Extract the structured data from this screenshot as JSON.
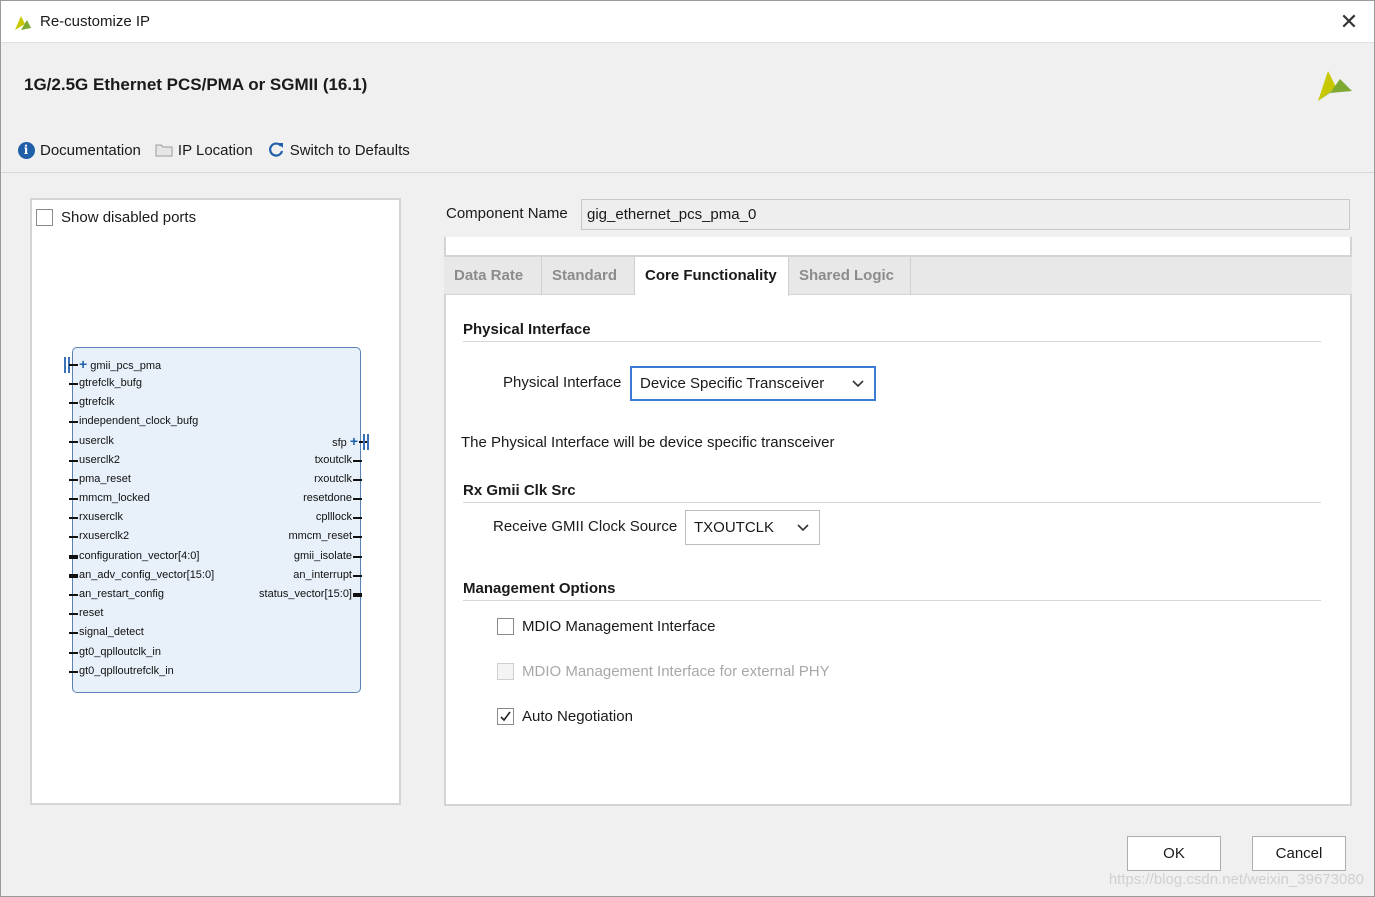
{
  "window": {
    "title": "Re-customize IP",
    "close_icon": "close-icon"
  },
  "header": {
    "ip_title": "1G/2.5G Ethernet PCS/PMA or SGMII (16.1)",
    "toolbar": [
      {
        "label": "Documentation",
        "icon": "info-icon"
      },
      {
        "label": "IP Location",
        "icon": "folder-icon"
      },
      {
        "label": "Switch to Defaults",
        "icon": "refresh-icon"
      }
    ]
  },
  "left_panel": {
    "show_disabled_ports": {
      "label": "Show disabled ports",
      "checked": false
    },
    "block": {
      "interface_top": "gmii_pcs_pma",
      "inputs": [
        "gtrefclk_bufg",
        "gtrefclk",
        "independent_clock_bufg",
        "userclk",
        "userclk2",
        "pma_reset",
        "mmcm_locked",
        "rxuserclk",
        "rxuserclk2",
        "configuration_vector[4:0]",
        "an_adv_config_vector[15:0]",
        "an_restart_config",
        "reset",
        "signal_detect",
        "gt0_qplloutclk_in",
        "gt0_qplloutrefclk_in"
      ],
      "interface_right": "sfp",
      "outputs": [
        "txoutclk",
        "rxoutclk",
        "resetdone",
        "cplllock",
        "mmcm_reset",
        "gmii_isolate",
        "an_interrupt",
        "status_vector[15:0]"
      ]
    }
  },
  "component": {
    "label": "Component Name",
    "value": "gig_ethernet_pcs_pma_0"
  },
  "tabs": [
    {
      "label": "Data Rate",
      "active": false
    },
    {
      "label": "Standard",
      "active": false
    },
    {
      "label": "Core Functionality",
      "active": true
    },
    {
      "label": "Shared Logic",
      "active": false
    }
  ],
  "core": {
    "physical_interface": {
      "section": "Physical Interface",
      "label": "Physical Interface",
      "value": "Device Specific Transceiver",
      "description": "The Physical Interface will be device specific transceiver"
    },
    "rx_gmii": {
      "section": "Rx Gmii Clk Src",
      "label": "Receive GMII Clock Source",
      "value": "TXOUTCLK"
    },
    "management": {
      "section": "Management Options",
      "options": [
        {
          "label": "MDIO Management Interface",
          "checked": false,
          "enabled": true
        },
        {
          "label": "MDIO Management Interface for external PHY",
          "checked": false,
          "enabled": false
        },
        {
          "label": "Auto Negotiation",
          "checked": true,
          "enabled": true
        }
      ]
    }
  },
  "buttons": {
    "ok": "OK",
    "cancel": "Cancel"
  },
  "watermark": "https://blog.csdn.net/weixin_39673080",
  "colors": {
    "accent": "#3a7bd5",
    "block_fill": "#e8f1fa",
    "block_border": "#5a82b4",
    "brand_yellow": "#c8c800",
    "brand_green": "#7da832"
  }
}
